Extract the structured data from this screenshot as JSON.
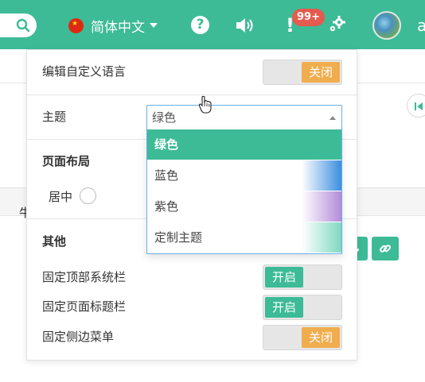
{
  "header": {
    "language": "简体中文",
    "help": "?",
    "alert_mark": "!",
    "notification_count": "99+",
    "user_initial": "a"
  },
  "settings": {
    "edit_language": {
      "label": "编辑自定义语言",
      "toggle_text": "关闭",
      "state": "off"
    },
    "theme": {
      "label": "主题",
      "selected": "绿色",
      "options": [
        {
          "label": "绿色",
          "swatch": "#3dbb96"
        },
        {
          "label": "蓝色",
          "swatch": "#3b8ee0"
        },
        {
          "label": "紫色",
          "swatch": "#b48bd8"
        },
        {
          "label": "定制主题",
          "swatch": "#7fd8c0"
        }
      ]
    },
    "layout": {
      "heading": "页面布局",
      "center_label": "居中"
    },
    "other": {
      "heading": "其他",
      "fixed_topbar": {
        "label": "固定顶部系统栏",
        "toggle_text": "开启",
        "state": "on"
      },
      "fixed_titlebar": {
        "label": "固定页面标题栏",
        "toggle_text": "开启",
        "state": "on"
      },
      "fixed_sidebar": {
        "label": "固定侧边菜单",
        "toggle_text": "关闭",
        "state": "off"
      }
    }
  },
  "background": {
    "partial_text": "牛"
  },
  "colors": {
    "primary": "#3dbb96",
    "warning": "#f0ad4e",
    "danger": "#e55a4e"
  }
}
